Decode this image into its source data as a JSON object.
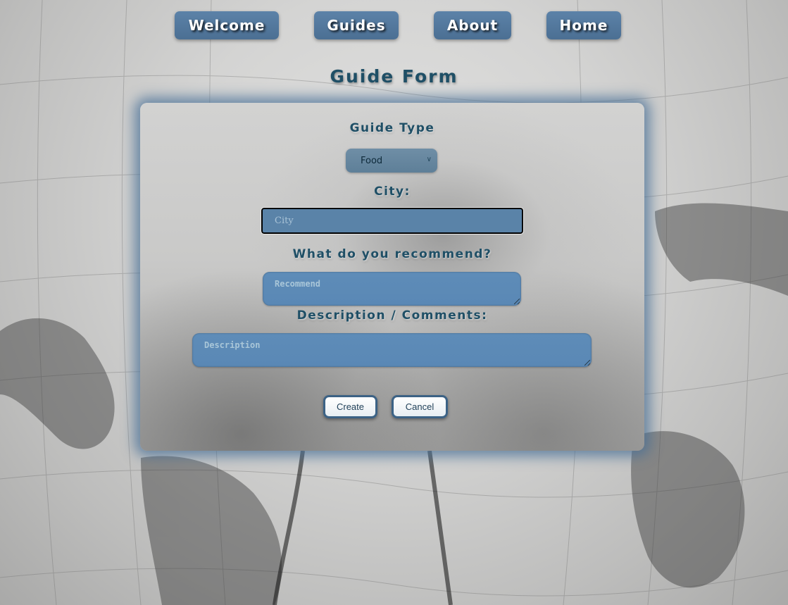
{
  "nav": {
    "welcome": "Welcome",
    "guides": "Guides",
    "about": "About",
    "home": "Home"
  },
  "page": {
    "title": "Guide Form"
  },
  "form": {
    "guide_type_label": "Guide Type",
    "guide_type_selected": "Food",
    "city_label": "City:",
    "city_placeholder": "City",
    "recommend_label": "What do you recommend?",
    "recommend_placeholder": "Recommend",
    "description_label": "Description / Comments:",
    "description_placeholder": "Description",
    "create_label": "Create",
    "cancel_label": "Cancel"
  },
  "colors": {
    "accent": "#4b6f93",
    "heading": "#1f4f66",
    "input_bg": "#5a83a8"
  }
}
